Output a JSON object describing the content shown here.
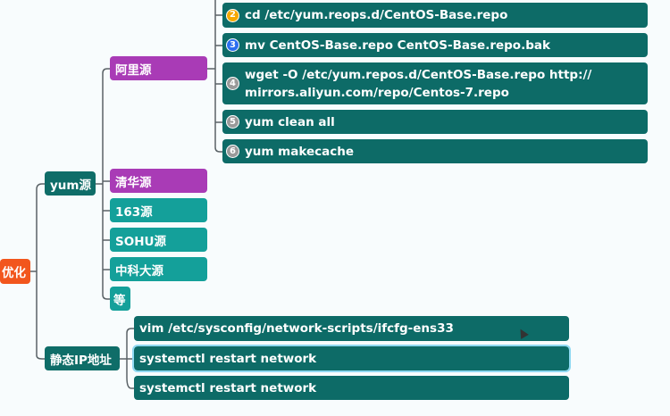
{
  "root": "优化",
  "branches": {
    "yum": {
      "label": "yum源",
      "sources": [
        "阿里源",
        "清华源",
        "163源",
        "SOHU源",
        "中科大源",
        "等"
      ],
      "aliyun_steps": [
        {
          "num": "2",
          "text": "cd /etc/yum.reops.d/CentOS-Base.repo",
          "color": "#f5a800"
        },
        {
          "num": "3",
          "text": "mv CentOS-Base.repo CentOS-Base.repo.bak",
          "color": "#2a6ef0"
        },
        {
          "num": "4",
          "text": "wget -O /etc/yum.repos.d/CentOS-Base.repo http:// mirrors.aliyun.com/repo/Centos-7.repo",
          "color": "#9a9a9a"
        },
        {
          "num": "5",
          "text": "yum clean all",
          "color": "#9a9a9a"
        },
        {
          "num": "6",
          "text": "yum makecache",
          "color": "#9a9a9a"
        }
      ]
    },
    "static_ip": {
      "label": "静态IP地址",
      "steps": [
        "vim /etc/sysconfig/network-scripts/ifcfg-ens33",
        "systemctl restart network",
        "systemctl restart network"
      ]
    }
  }
}
